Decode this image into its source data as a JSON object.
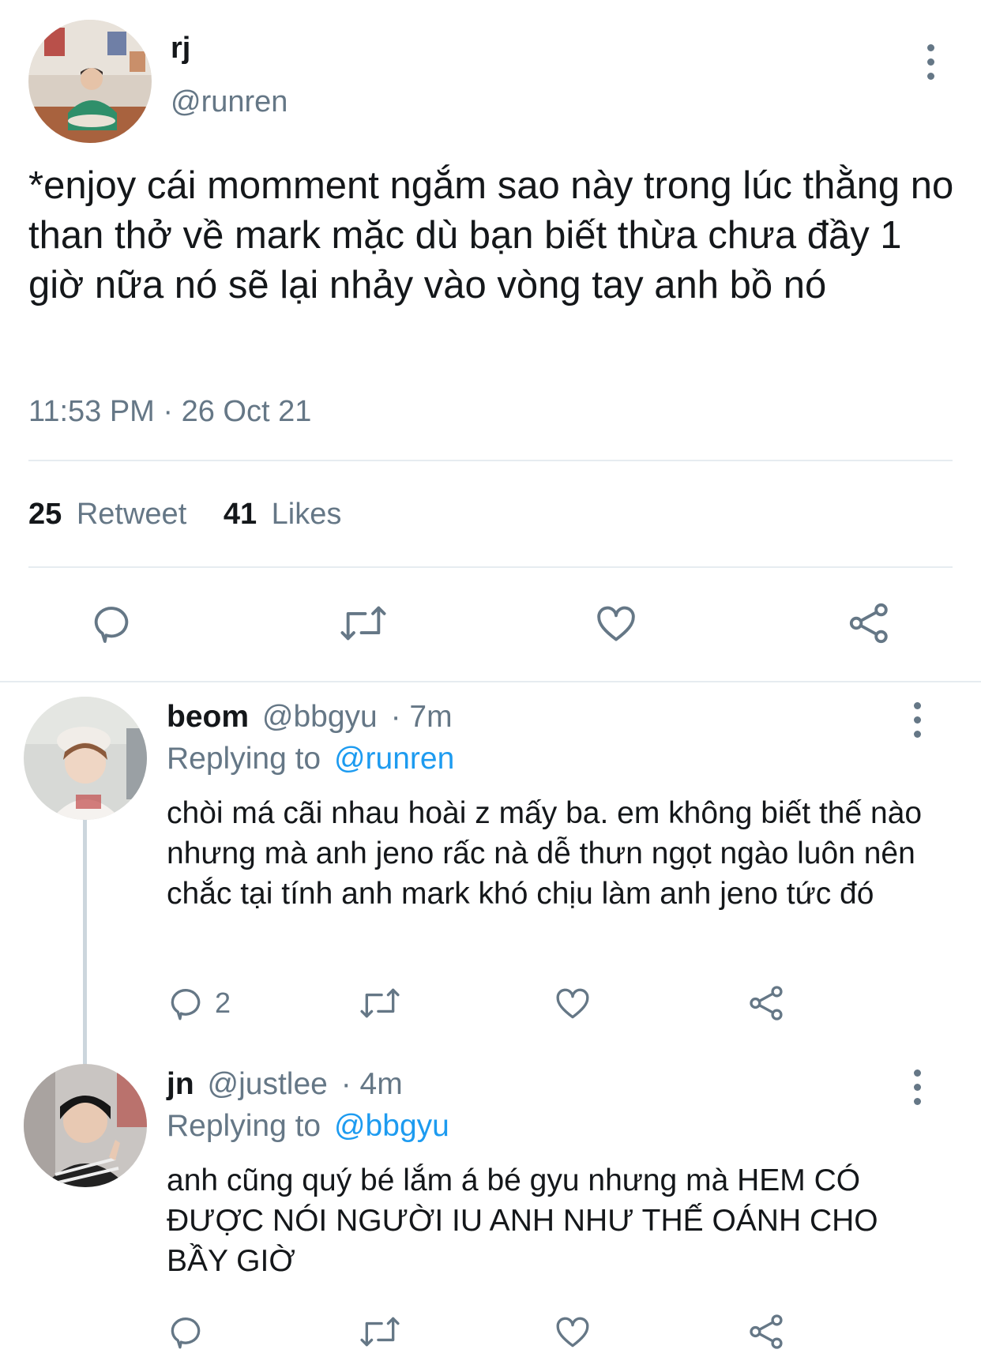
{
  "main_tweet": {
    "display_name": "rj",
    "handle": "@runren",
    "text": "*enjoy cái momment ngắm sao này trong lúc thằng no than thở về mark mặc dù bạn biết thừa chưa đầy 1 giờ nữa nó sẽ lại nhảy vào vòng tay anh bồ nó",
    "timestamp": "11:53 PM · 26 Oct 21",
    "retweet_count": "25",
    "retweet_label": "Retweet",
    "like_count": "41",
    "like_label": "Likes"
  },
  "replies": [
    {
      "display_name": "beom",
      "handle": "@bbgyu",
      "time": "· 7m",
      "replying_prefix": "Replying to",
      "replying_to": "@runren",
      "text": "chòi má cãi nhau hoài z mấy ba. em không biết thế nào nhưng mà anh jeno rấc nà dễ thưn ngọt ngào luôn nên chắc tại tính anh mark khó chịu làm anh jeno tức đó",
      "reply_count": "2"
    },
    {
      "display_name": "jn",
      "handle": "@justlee",
      "time": "· 4m",
      "replying_prefix": "Replying to",
      "replying_to": "@bbgyu",
      "text": "anh cũng quý bé lắm á bé gyu nhưng mà HEM CÓ ĐƯỢC NÓI NGƯỜI IU ANH NHƯ THẾ OÁNH CHO BẦY GIỜ",
      "reply_count": ""
    }
  ],
  "icons": [
    "more-icon",
    "reply-icon",
    "retweet-icon",
    "like-icon",
    "share-icon"
  ],
  "colors": {
    "text": "#14171a",
    "muted": "#657786",
    "link": "#1d9bf0",
    "divider": "#e6ecf0"
  }
}
